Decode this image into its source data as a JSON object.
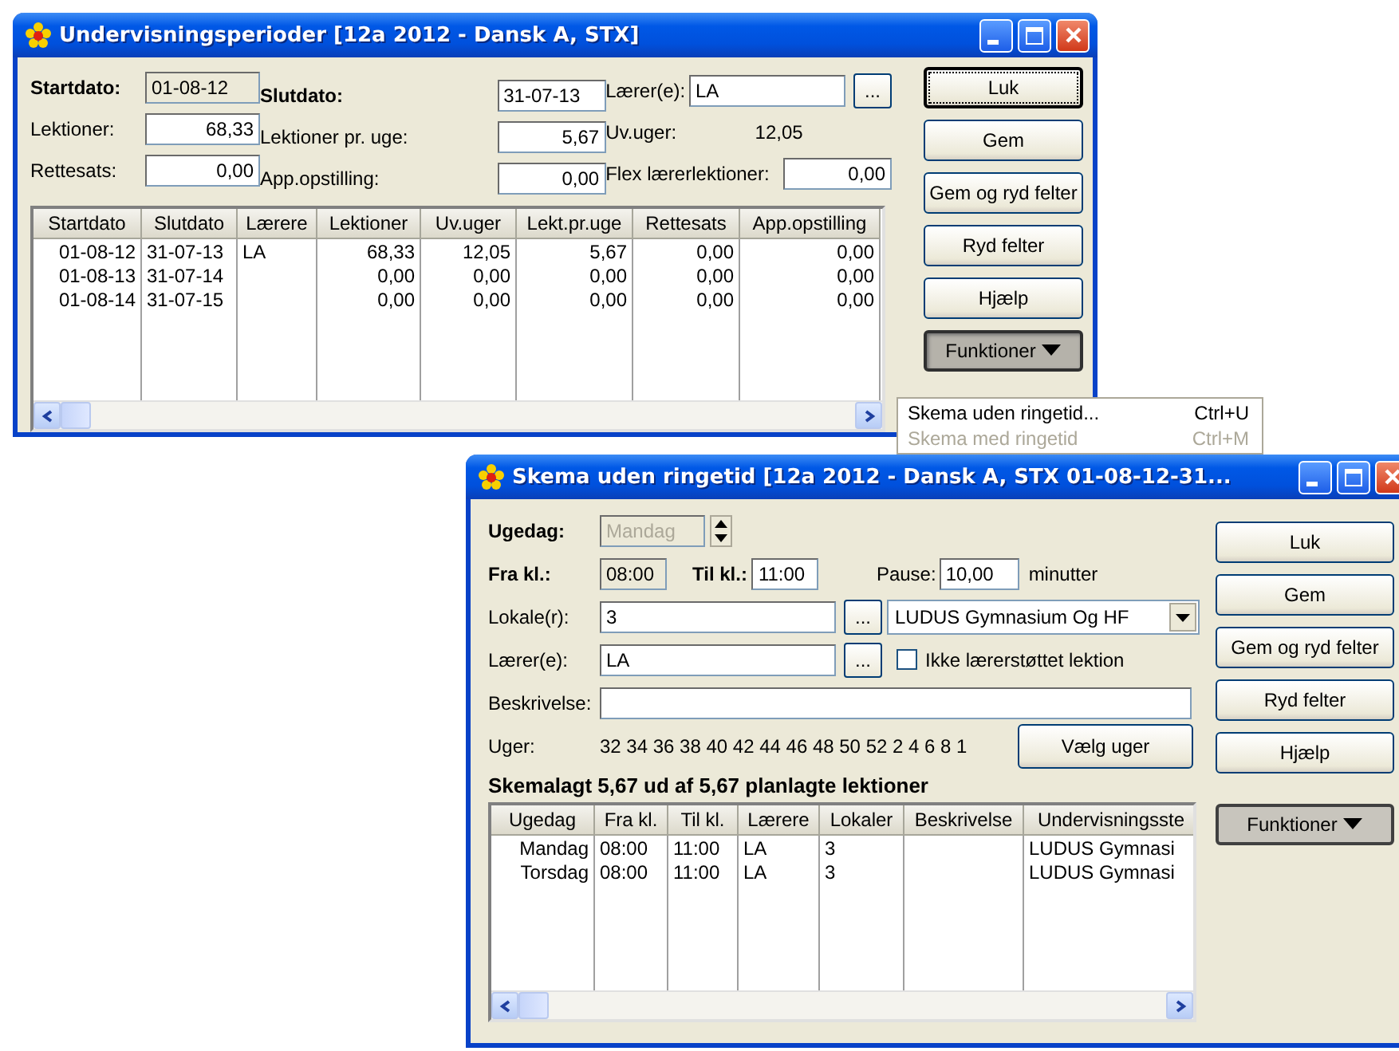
{
  "main_window": {
    "title": "Undervisningsperioder [12a 2012 - Dansk A, STX]",
    "field_rows": [
      [
        {
          "kind": "input",
          "label": "Startdato:",
          "bold": true,
          "value": "01-08-12",
          "readonly": true
        },
        {
          "kind": "input",
          "label": "Slutdato:",
          "bold": true,
          "value": "31-07-13",
          "readonly": false
        },
        {
          "kind": "browse",
          "label": "Lærer(e):",
          "bold": false,
          "value": "LA",
          "readonly": false,
          "browse": "..."
        }
      ],
      [
        {
          "kind": "input",
          "label": "Lektioner:",
          "bold": false,
          "value": "68,33",
          "readonly": false
        },
        {
          "kind": "input",
          "label": "Lektioner pr. uge:",
          "bold": false,
          "value": "5,67",
          "readonly": false
        },
        {
          "kind": "text",
          "label": "Uv.uger:",
          "bold": false,
          "value": "12,05"
        }
      ],
      [
        {
          "kind": "input",
          "label": "Rettesats:",
          "bold": false,
          "value": "0,00",
          "readonly": false
        },
        {
          "kind": "input",
          "label": "App.opstilling:",
          "bold": false,
          "value": "0,00",
          "readonly": false
        },
        {
          "kind": "input",
          "label": "Flex lærerlektioner:",
          "bold": false,
          "value": "0,00",
          "readonly": false
        }
      ]
    ],
    "table": {
      "columns": [
        "Startdato",
        "Slutdato",
        "Lærere",
        "Lektioner",
        "Uv.uger",
        "Lekt.pr.uge",
        "Rettesats",
        "App.opstilling"
      ],
      "rows": [
        [
          "01-08-12",
          "31-07-13",
          "LA",
          "68,33",
          "12,05",
          "5,67",
          "0,00",
          "0,00"
        ],
        [
          "01-08-13",
          "31-07-14",
          "",
          "0,00",
          "0,00",
          "0,00",
          "0,00",
          "0,00"
        ],
        [
          "01-08-14",
          "31-07-15",
          "",
          "0,00",
          "0,00",
          "0,00",
          "0,00",
          "0,00"
        ]
      ]
    },
    "buttons": [
      {
        "kind": "push",
        "label": "Luk",
        "focused": true,
        "pressed": false
      },
      {
        "kind": "push",
        "label": "Gem",
        "focused": false,
        "pressed": false
      },
      {
        "kind": "push",
        "label": "Gem og ryd felter",
        "focused": false,
        "pressed": false
      },
      {
        "kind": "push",
        "label": "Ryd felter",
        "focused": false,
        "pressed": false
      },
      {
        "kind": "push",
        "label": "Hjælp",
        "focused": false,
        "pressed": false
      },
      {
        "kind": "menu",
        "label": "Funktioner",
        "focused": false,
        "pressed": true
      }
    ]
  },
  "menu": {
    "items": [
      {
        "label": "Skema uden ringetid...",
        "shortcut": "Ctrl+U",
        "disabled": false
      },
      {
        "label": "Skema med ringetid",
        "shortcut": "Ctrl+M",
        "disabled": true
      }
    ]
  },
  "schedule_window": {
    "title": "Skema uden ringetid [12a 2012 - Dansk A, STX  01-08-12-31...",
    "weekday": {
      "label": "Ugedag:",
      "value": "Mandag",
      "disabled": true
    },
    "from": {
      "label": "Fra kl.:",
      "value": "08:00",
      "readonly": true
    },
    "to": {
      "label": "Til kl.:",
      "value": "11:00",
      "readonly": false
    },
    "pause": {
      "label": "Pause:",
      "value": "10,00",
      "unit": "minutter"
    },
    "rooms": {
      "label": "Lokale(r):",
      "value": "3",
      "browse": "...",
      "location": "LUDUS Gymnasium Og HF"
    },
    "teachers": {
      "label": "Lærer(e):",
      "value": "LA",
      "browse": "...",
      "checkbox": {
        "label": "Ikke lærerstøttet lektion",
        "checked": false
      }
    },
    "description": {
      "label": "Beskrivelse:"
    },
    "weeks": {
      "label": "Uger:",
      "value": "32 34 36 38 40 42 44 46 48 50 52 2 4 6 8 1",
      "button": "Vælg uger"
    },
    "summary": "Skemalagt 5,67 ud af 5,67 planlagte lektioner",
    "table": {
      "columns": [
        "Ugedag",
        "Fra kl.",
        "Til kl.",
        "Lærere",
        "Lokaler",
        "Beskrivelse",
        "Undervisningsste"
      ],
      "rows": [
        [
          "Mandag",
          "08:00",
          "11:00",
          "LA",
          "3",
          "",
          "LUDUS Gymnasi"
        ],
        [
          "Torsdag",
          "08:00",
          "11:00",
          "LA",
          "3",
          "",
          "LUDUS Gymnasi"
        ]
      ]
    },
    "buttons": [
      {
        "kind": "push",
        "label": "Luk",
        "focused": false,
        "pressed": false
      },
      {
        "kind": "push",
        "label": "Gem",
        "focused": false,
        "pressed": false
      },
      {
        "kind": "push",
        "label": "Gem og ryd felter",
        "focused": false,
        "pressed": false
      },
      {
        "kind": "push",
        "label": "Ryd felter",
        "focused": false,
        "pressed": false
      },
      {
        "kind": "push",
        "label": "Hjælp",
        "focused": false,
        "pressed": false
      },
      {
        "kind": "menu",
        "label": "Funktioner",
        "focused": false,
        "pressed": false
      }
    ]
  }
}
